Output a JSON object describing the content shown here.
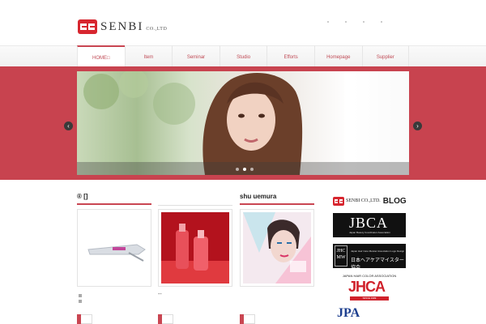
{
  "header": {
    "brand_name": "SENBI",
    "brand_suffix": "CO.,LTD"
  },
  "nav": {
    "items": [
      {
        "label": "HOME□"
      },
      {
        "label": "Item"
      },
      {
        "label": "Seminar"
      },
      {
        "label": "Studio"
      },
      {
        "label": "Efforts"
      },
      {
        "label": "Homepage"
      },
      {
        "label": "Supplier"
      }
    ]
  },
  "slider": {
    "prev_label": "‹",
    "next_label": "›",
    "slide_count": 3,
    "active_slide": 2
  },
  "columns": [
    {
      "title": "® []"
    },
    {
      "title": ""
    },
    {
      "title": "shu uemura"
    }
  ],
  "column_captions": {
    "second": "--"
  },
  "sidebar": {
    "blog_logo": "SENBI CO.,LTD.",
    "blog_word": "BLOG",
    "jbca_title": "JBCA",
    "jbca_sub": "Japan Beauty Coordinator Association",
    "jhcm_mark": "JHC MW",
    "jhcm_sub": "Japan Hair Care Meister Association Logo Design",
    "jhcm_jp": "日本ヘアケアマイスター協会",
    "jhca_top": "JAPAN HAIR COLOR ASSOCIATION",
    "jhca_title": "JHCA",
    "jhca_since": "SINCE 1999",
    "jpa_title": "JPA"
  },
  "colors": {
    "accent": "#c94652",
    "band": "#c8434f",
    "nav_text": "#c04b56"
  }
}
